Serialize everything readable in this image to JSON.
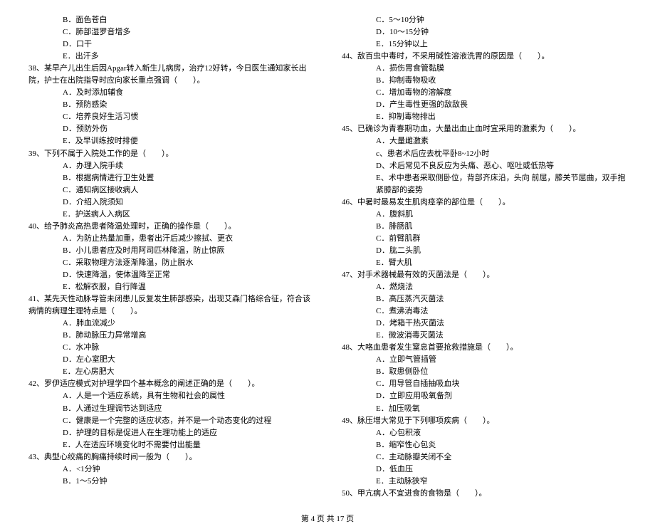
{
  "left": {
    "opts_pre": [
      "B．面色苍白",
      "C．肺部湿罗音增多",
      "D．口干",
      "E．出汗多"
    ],
    "q38": "38、某早产儿出生后因Apgar转入新生儿病房，治疗12好转，今日医生通知家长出院，护士在出院指导时应向家长重点强调（　　）。",
    "q38_opts": [
      "A．及时添加辅食",
      "B．预防感染",
      "C．培养良好生活习惯",
      "D．预防外伤",
      "E．及早训练按时排便"
    ],
    "q39": "39、下列不属于入院处工作的是（　　）。",
    "q39_opts": [
      "A．办理入院手续",
      "B．根据病情进行卫生处置",
      "C．通知病区接收病人",
      "D．介绍入院须知",
      "E．护送病人入病区"
    ],
    "q40": "40、给予肺炎高热患者降温处理时，正确的操作是（　　）。",
    "q40_opts": [
      "A．为防止热量加重，患者出汗后减少擦拭、更衣",
      "B．小儿患者应及时用阿司匹林降温，防止惊厥",
      "C．采取物理方法逐渐降温，防止脱水",
      "D．快速降温，使体温降至正常",
      "E．松解衣服，自行降温"
    ],
    "q41": "41、某先天性动脉导管未闭患儿反复发生肺部感染，出现艾森门格综合征，符合该病情的病理生理特点是（　　）。",
    "q41_opts": [
      "A．肺血流减少",
      "B．肺动脉压力异常增高",
      "C．水冲脉",
      "D．左心室肥大",
      "E．左心房肥大"
    ],
    "q42": "42、罗伊适应模式对护理学四个基本概念的阐述正确的是（　　）。",
    "q42_opts": [
      "A．人是一个适应系统，具有生物和社会的属性",
      "B．人通过生理调节达到适应",
      "C．健康是一个完整的适应状态，并不是一个动态变化的过程",
      "D．护理的目标是促进人在生理功能上的适应",
      "E．人在适应环境变化时不需要付出能量"
    ],
    "q43": "43、典型心绞痛的胸痛持续时间一般为（　　）。",
    "q43_opts": [
      "A．<1分钟",
      "B．1～5分钟"
    ]
  },
  "right": {
    "opts_pre": [
      "C．5～10分钟",
      "D．10～15分钟",
      "E．15分钟以上"
    ],
    "q44": "44、敌百虫中毒时，不采用碱性溶液洗胃的原因是（　　）。",
    "q44_opts": [
      "A．损伤胃食管黏膜",
      "B．抑制毒物吸收",
      "C．增加毒物的溶解度",
      "D．产生毒性更强的敌敌畏",
      "E．抑制毒物排出"
    ],
    "q45": "45、已确诊为青春期功血，大量出血止血时宜采用的激素为（　　）。",
    "q45_opts": [
      "A．大量雌激素",
      "c、患者术后应去枕平卧8~12小时",
      "D、术后常见不良反应为头痛、恶心、呕吐或低热等",
      "E、术中患者采取侧卧位，背部齐床沿，头向 前屈，膝关节屈曲，双手抱紧膝部的姿势"
    ],
    "q46": "46、中暑时最易发生肌肉痉挛的部位是（　　）。",
    "q46_opts": [
      "A．腹斜肌",
      "B．腓肠肌",
      "C．前臂肌群",
      "D．肱二头肌",
      "E．臂大肌"
    ],
    "q47": "47、对手术器械最有效的灭菌法是（　　）。",
    "q47_opts": [
      "A．燃烧法",
      "B．高压蒸汽灭菌法",
      "C．煮沸消毒法",
      "D．烤箱干热灭菌法",
      "E．微波消毒灭菌法"
    ],
    "q48": "48、大咯血患者发生窒息首要抢救措施是（　　）。",
    "q48_opts": [
      "A．立即气管插管",
      "B．取患侧卧位",
      "C．用导管自插抽吸血块",
      "D．立即应用吸氧备剂",
      "E．加压吸氧"
    ],
    "q49": "49、脉压增大常见于下列哪项疾病（　　）。",
    "q49_opts": [
      "A．心包积液",
      "B．缩窄性心包炎",
      "C．主动脉瓣关闭不全",
      "D．低血压",
      "E．主动脉狭窄"
    ],
    "q50": "50、甲亢病人不宜进食的食物是（　　）。"
  },
  "footer": "第 4 页 共 17 页"
}
